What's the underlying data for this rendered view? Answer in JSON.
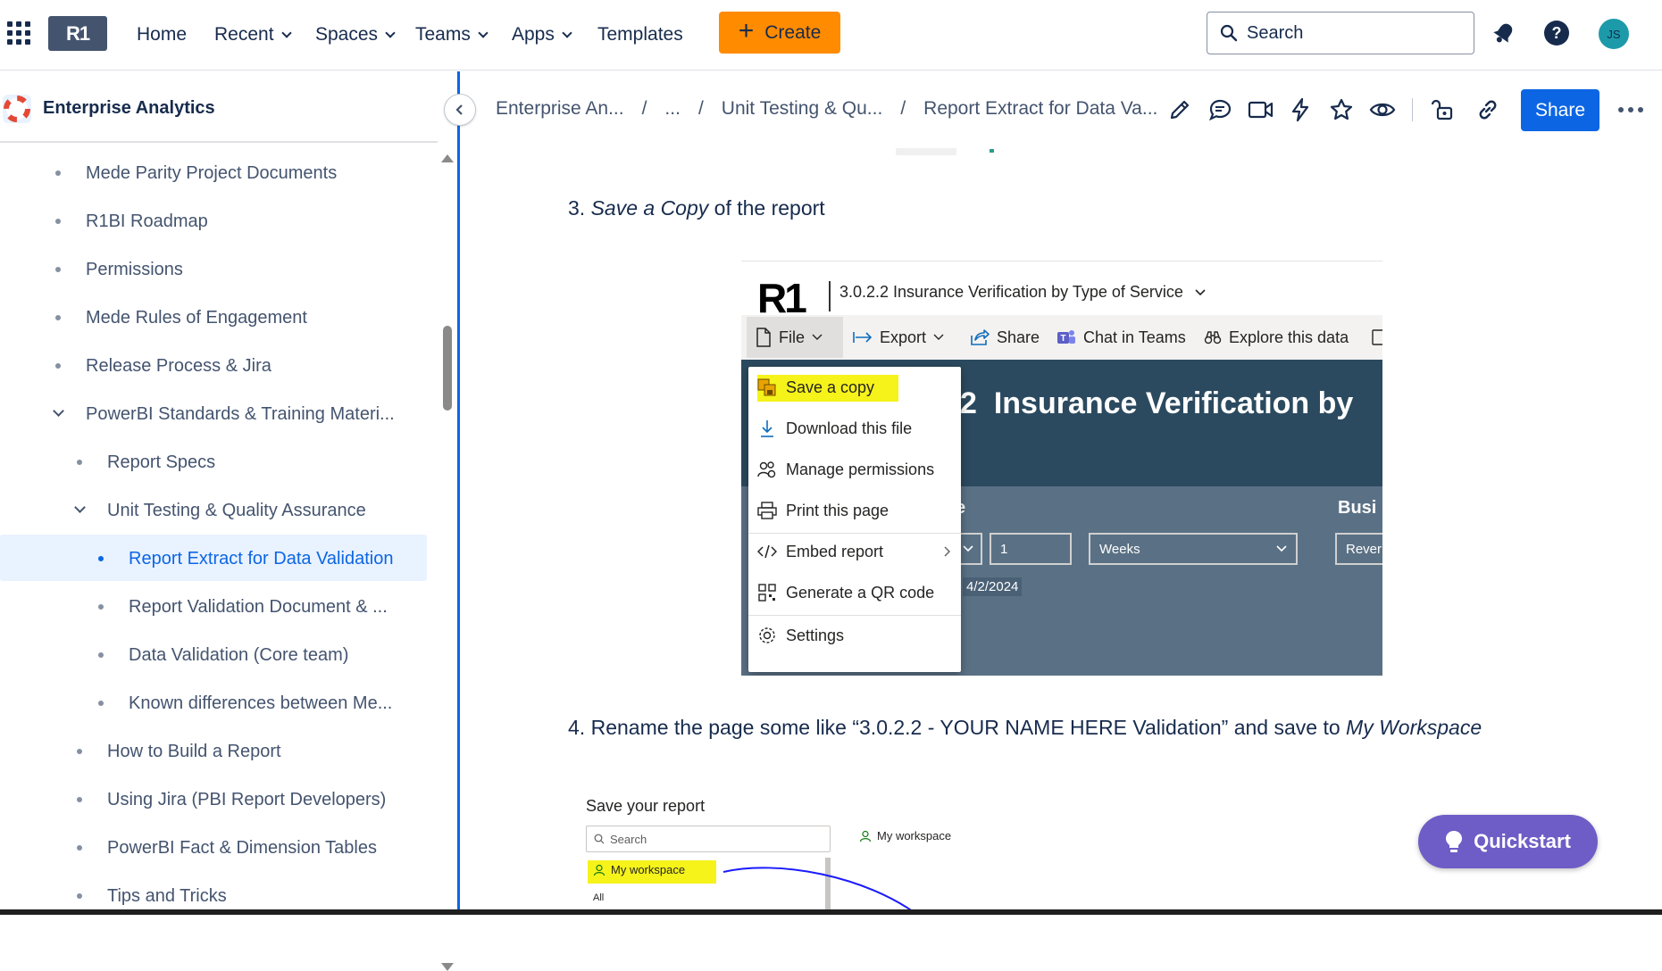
{
  "topbar": {
    "logo_text": "R1",
    "nav": [
      "Home",
      "Recent",
      "Spaces",
      "Teams",
      "Apps",
      "Templates"
    ],
    "create_label": "Create",
    "search_placeholder": "Search",
    "avatar_initials": "JS"
  },
  "sidebar": {
    "space_title": "Enterprise Analytics",
    "items": [
      {
        "label": "Mede Parity Project Documents"
      },
      {
        "label": "R1BI Roadmap"
      },
      {
        "label": "Permissions"
      },
      {
        "label": "Mede Rules of Engagement"
      },
      {
        "label": "Release Process & Jira"
      },
      {
        "label": "PowerBI Standards & Training Materi..."
      },
      {
        "label": "Report Specs"
      },
      {
        "label": "Unit Testing & Quality Assurance"
      },
      {
        "label": "Report Extract for Data Validation"
      },
      {
        "label": "Report Validation Document & ..."
      },
      {
        "label": "Data Validation (Core team)"
      },
      {
        "label": "Known differences between Me..."
      },
      {
        "label": "How to Build a Report"
      },
      {
        "label": "Using Jira (PBI Report Developers)"
      },
      {
        "label": "PowerBI Fact & Dimension Tables"
      },
      {
        "label": "Tips and Tricks"
      }
    ]
  },
  "breadcrumb": [
    "Enterprise An...",
    "...",
    "Unit Testing & Qu...",
    "Report Extract for Data Va..."
  ],
  "page_actions": {
    "share_label": "Share"
  },
  "content": {
    "step3": {
      "num": "3.",
      "em": "Save a Copy",
      "rest": " of the report"
    },
    "step4": {
      "num": "4.",
      "text": "Rename the page some like “3.0.2.2 - YOUR NAME HERE Validation” and save to ",
      "em": "My Workspace"
    },
    "shot1": {
      "logo": "R1",
      "report_title": "3.0.2.2 Insurance Verification by Type of Service",
      "toolbar": [
        "File",
        "Export",
        "Share",
        "Chat in Teams",
        "Explore this data"
      ],
      "menu": [
        "Save a copy",
        "Download this file",
        "Manage permissions",
        "Print this page",
        "Embed report",
        "Generate a QR code",
        "Settings"
      ],
      "heading_num": "2",
      "heading": "Insurance Verification by",
      "label_e": "e",
      "label_busi": "Busi",
      "field_num": "1",
      "field_weeks": "Weeks",
      "field_rever": "Rever",
      "date": "4/2/2024"
    },
    "shot2": {
      "title": "Save your report",
      "search_placeholder": "Search",
      "my_workspace": "My workspace",
      "all": "All",
      "workspace_right": "My workspace"
    }
  },
  "quickstart_label": "Quickstart",
  "colors": {
    "accent": "#0c66e4",
    "create": "#ff8b00",
    "quickstart": "#6e5dc6",
    "highlight": "#f6f31b"
  }
}
